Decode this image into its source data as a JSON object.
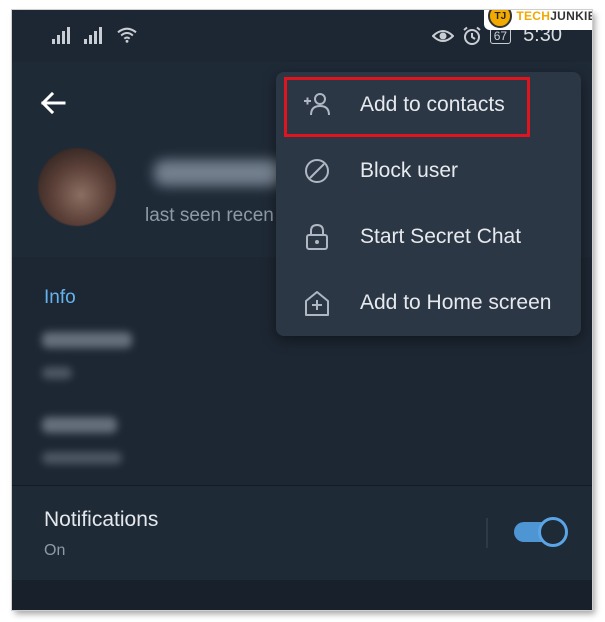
{
  "status_bar": {
    "time": "5:30",
    "battery": "67",
    "icons": [
      "signal-icon",
      "signal-icon",
      "wifi-icon",
      "eye-icon",
      "alarm-icon",
      "battery-icon"
    ]
  },
  "watermark": {
    "brand_left": "TECH",
    "brand_right": "JUNKIE",
    "badge": "TJ"
  },
  "header": {
    "back_icon": "arrow-left-icon",
    "last_seen": "last seen recen"
  },
  "info": {
    "title": "Info"
  },
  "notifications": {
    "title": "Notifications",
    "status": "On",
    "toggle_on": true
  },
  "menu": {
    "items": [
      {
        "label": "Add to contacts",
        "icon": "add-contact-icon",
        "highlighted": true
      },
      {
        "label": "Block user",
        "icon": "block-icon"
      },
      {
        "label": "Start Secret Chat",
        "icon": "lock-icon"
      },
      {
        "label": "Add to Home screen",
        "icon": "home-add-icon"
      }
    ]
  },
  "colors": {
    "background": "#1d2733",
    "menu_background": "#2b3745",
    "accent_blue": "#65b3ee",
    "highlight_red": "#e0141e"
  }
}
